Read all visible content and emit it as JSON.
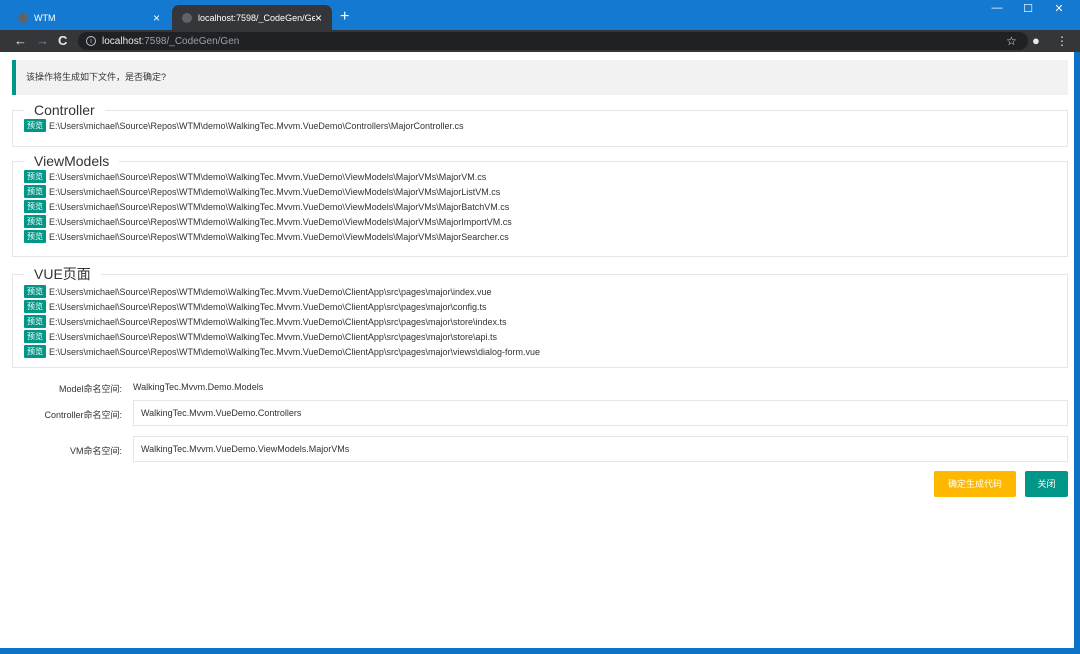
{
  "browser": {
    "tabs": [
      {
        "title": "WTM",
        "active": false
      },
      {
        "title": "localhost:7598/_CodeGen/Gen",
        "active": true
      }
    ],
    "new_tab": "+",
    "close_glyph": "×",
    "url_host": "localhost",
    "url_path": ":7598/_CodeGen/Gen",
    "window_controls": {
      "minimize": "—",
      "maximize": "☐",
      "close": "✕"
    },
    "nav": {
      "back": "←",
      "forward": "→",
      "reload": "C"
    },
    "toolbar_icons": {
      "bookmark": "☆",
      "profile": "●",
      "menu": "⋮",
      "info": "i"
    }
  },
  "notice": "该操作将生成如下文件，是否确定?",
  "preview_label": "预览",
  "groups": [
    {
      "legend": "Controller",
      "files": [
        "E:\\Users\\michael\\Source\\Repos\\WTM\\demo\\WalkingTec.Mvvm.VueDemo\\Controllers\\MajorController.cs"
      ]
    },
    {
      "legend": "ViewModels",
      "files": [
        "E:\\Users\\michael\\Source\\Repos\\WTM\\demo\\WalkingTec.Mvvm.VueDemo\\ViewModels\\MajorVMs\\MajorVM.cs",
        "E:\\Users\\michael\\Source\\Repos\\WTM\\demo\\WalkingTec.Mvvm.VueDemo\\ViewModels\\MajorVMs\\MajorListVM.cs",
        "E:\\Users\\michael\\Source\\Repos\\WTM\\demo\\WalkingTec.Mvvm.VueDemo\\ViewModels\\MajorVMs\\MajorBatchVM.cs",
        "E:\\Users\\michael\\Source\\Repos\\WTM\\demo\\WalkingTec.Mvvm.VueDemo\\ViewModels\\MajorVMs\\MajorImportVM.cs",
        "E:\\Users\\michael\\Source\\Repos\\WTM\\demo\\WalkingTec.Mvvm.VueDemo\\ViewModels\\MajorVMs\\MajorSearcher.cs"
      ]
    },
    {
      "legend": "VUE页面",
      "files": [
        "E:\\Users\\michael\\Source\\Repos\\WTM\\demo\\WalkingTec.Mvvm.VueDemo\\ClientApp\\src\\pages\\major\\index.vue",
        "E:\\Users\\michael\\Source\\Repos\\WTM\\demo\\WalkingTec.Mvvm.VueDemo\\ClientApp\\src\\pages\\major\\config.ts",
        "E:\\Users\\michael\\Source\\Repos\\WTM\\demo\\WalkingTec.Mvvm.VueDemo\\ClientApp\\src\\pages\\major\\store\\index.ts",
        "E:\\Users\\michael\\Source\\Repos\\WTM\\demo\\WalkingTec.Mvvm.VueDemo\\ClientApp\\src\\pages\\major\\store\\api.ts",
        "E:\\Users\\michael\\Source\\Repos\\WTM\\demo\\WalkingTec.Mvvm.VueDemo\\ClientApp\\src\\pages\\major\\views\\dialog-form.vue"
      ]
    }
  ],
  "form": {
    "model_ns_label": "Model命名空间:",
    "model_ns_value": "WalkingTec.Mvvm.Demo.Models",
    "controller_ns_label": "Controller命名空间:",
    "controller_ns_value": "WalkingTec.Mvvm.VueDemo.Controllers",
    "vm_ns_label": "VM命名空间:",
    "vm_ns_value": "WalkingTec.Mvvm.VueDemo.ViewModels.MajorVMs"
  },
  "buttons": {
    "confirm": "确定生成代码",
    "close": "关闭"
  },
  "colors": {
    "accent": "#009688",
    "warn": "#ffb800",
    "titlebar": "#1479d1",
    "toolbar": "#35363a"
  }
}
